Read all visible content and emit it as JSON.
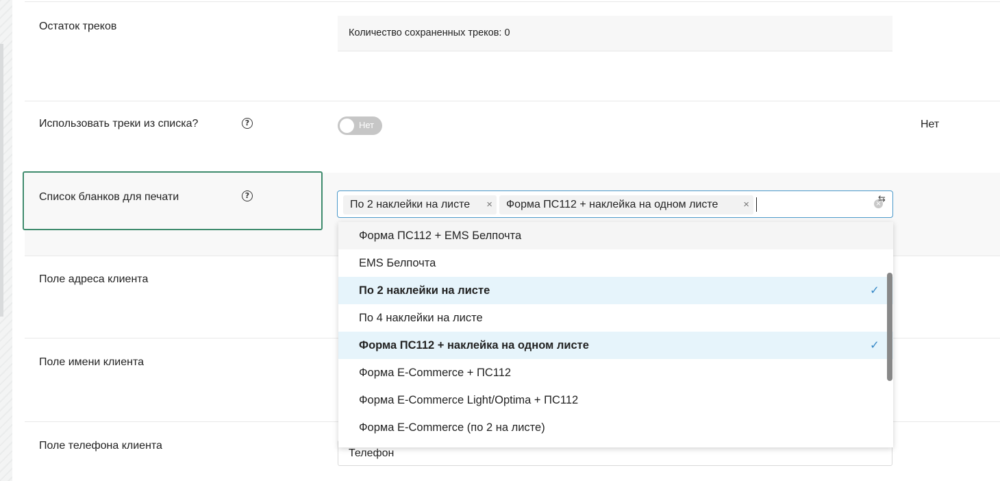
{
  "rows": {
    "tracks_remaining": {
      "label": "Остаток треков",
      "info": "Количество сохраненных треков: 0"
    },
    "use_tracks": {
      "label": "Использовать треки из списка?",
      "toggle_label": "Нет",
      "toggle_on": false,
      "value": "Нет"
    },
    "print_forms": {
      "label": "Список бланков для печати",
      "selected_tags": [
        "По 2 наклейки на листе",
        "Форма ПС112 + наклейка на одном листе"
      ],
      "tag_remove_glyph": "×",
      "clear_glyph": "×",
      "sort_glyph": "⇆"
    },
    "client_address": {
      "label": "Поле адреса клиента"
    },
    "client_name": {
      "label": "Поле имени клиента"
    },
    "client_phone": {
      "label": "Поле телефона клиента",
      "value": "Телефон"
    }
  },
  "help_glyph": "?",
  "dropdown": {
    "options": [
      {
        "label": "Форма ПС112 + EMS Белпочта",
        "selected": false,
        "hover": true
      },
      {
        "label": "EMS Белпочта",
        "selected": false,
        "hover": false
      },
      {
        "label": "По 2 наклейки на листе",
        "selected": true,
        "hover": false
      },
      {
        "label": "По 4 наклейки на листе",
        "selected": false,
        "hover": false
      },
      {
        "label": "Форма ПС112 + наклейка на одном листе",
        "selected": true,
        "hover": false
      },
      {
        "label": "Форма E-Commerce + ПС112",
        "selected": false,
        "hover": false
      },
      {
        "label": "Форма E-Commerce Light/Optima + ПС112",
        "selected": false,
        "hover": false
      },
      {
        "label": "Форма E-Commerce (по 2 на листе)",
        "selected": false,
        "hover": false
      }
    ],
    "check_glyph": "✓"
  },
  "colors": {
    "accent_blue": "#4a98c9",
    "check_blue": "#3487c6",
    "selected_bg": "#e6f4fb",
    "highlight_green": "#3d8a6c",
    "toggle_off": "#c6c6c6"
  }
}
